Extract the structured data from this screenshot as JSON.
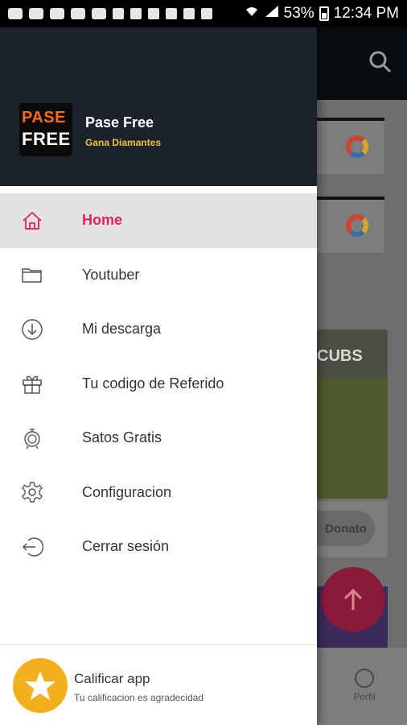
{
  "status_bar": {
    "battery": "53%",
    "time": "12:34 PM"
  },
  "drawer": {
    "app_name": "Pase Free",
    "app_subtitle": "Gana Diamantes",
    "logo_line1": "PASE",
    "logo_line2": "FREE",
    "items": [
      {
        "label": "Home",
        "icon": "home-icon",
        "active": true
      },
      {
        "label": "Youtuber",
        "icon": "folder-icon"
      },
      {
        "label": "Mi descarga",
        "icon": "download-icon"
      },
      {
        "label": "Tu codigo de Referido",
        "icon": "gift-icon"
      },
      {
        "label": "Satos Gratis",
        "icon": "stopwatch-icon"
      },
      {
        "label": "Configuracion",
        "icon": "gear-icon"
      },
      {
        "label": "Cerrar sesión",
        "icon": "logout-icon"
      }
    ],
    "footer": {
      "title": "Calificar app",
      "subtitle": "Tu calificacion es agradecidad"
    }
  },
  "background": {
    "image_text": "CUBS",
    "donate_label": "Donato",
    "profile_label": "Perfil"
  },
  "colors": {
    "accent": "#e91e63",
    "header_bg": "#1b222b",
    "subtitle": "#f0c23b",
    "star": "#f2b01e"
  }
}
